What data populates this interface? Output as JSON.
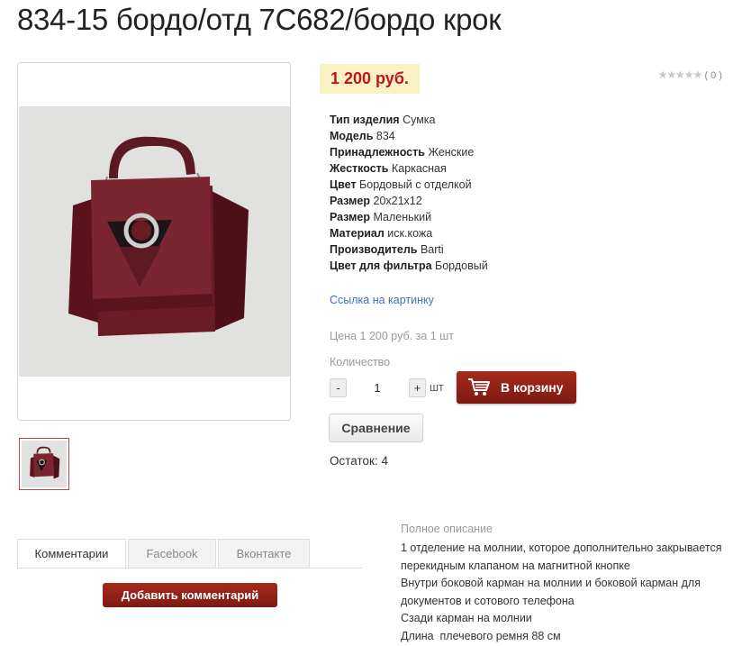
{
  "product": {
    "title": "834-15 бордо/отд 7C682/бордо крок",
    "price": "1 200 руб.",
    "rating": {
      "stars": "★★★★★",
      "count": "( 0 )",
      "value": 0
    },
    "properties": [
      {
        "name": "Тип изделия",
        "value": "Сумка"
      },
      {
        "name": "Модель",
        "value": "834"
      },
      {
        "name": "Принадлежность",
        "value": "Женские"
      },
      {
        "name": "Жесткость",
        "value": "Каркасная"
      },
      {
        "name": "Цвет",
        "value": "Бордовый с отделкой"
      },
      {
        "name": "Размер",
        "value": "20x21x12"
      },
      {
        "name": "Размер",
        "value": "Маленький"
      },
      {
        "name": "Материал",
        "value": "иск.кожа"
      },
      {
        "name": "Производитель",
        "value": "Barti"
      },
      {
        "name": "Цвет для фильтра",
        "value": "Бордовый"
      }
    ],
    "image_link": "Ссылка на картинку",
    "price_per_unit": "Цена 1 200 руб. за 1 шт",
    "quantity_label": "Количество",
    "quantity_value": "1",
    "minus": "-",
    "plus": "+",
    "unit": "шт",
    "add_to_cart": "В корзину",
    "compare": "Сравнение",
    "stock": "Остаток: 4"
  },
  "tabs": [
    {
      "label": "Комментарии",
      "active": true
    },
    {
      "label": "Facebook",
      "active": false
    },
    {
      "label": "Вконтакте",
      "active": false
    }
  ],
  "add_comment": "Добавить комментарий",
  "description": {
    "title": "Полное описание",
    "lines": [
      "1 отделение на молнии, которое дополнительно закрывается перекидным клапаном на магнитной кнопке",
      "Внутри боковой карман на молнии и боковой карман для документов и сотового телефона",
      "Сзади карман на молнии",
      "Длина  плечевого ремня 88 см"
    ]
  },
  "colors": {
    "price_bg": "#f8f2c4",
    "price_text": "#c0141e",
    "accent_button": "#8e2116",
    "link": "#3a74b5",
    "bag": "#6e1c24"
  },
  "icons": [
    "cart-icon",
    "star-icon",
    "bag-photo"
  ]
}
